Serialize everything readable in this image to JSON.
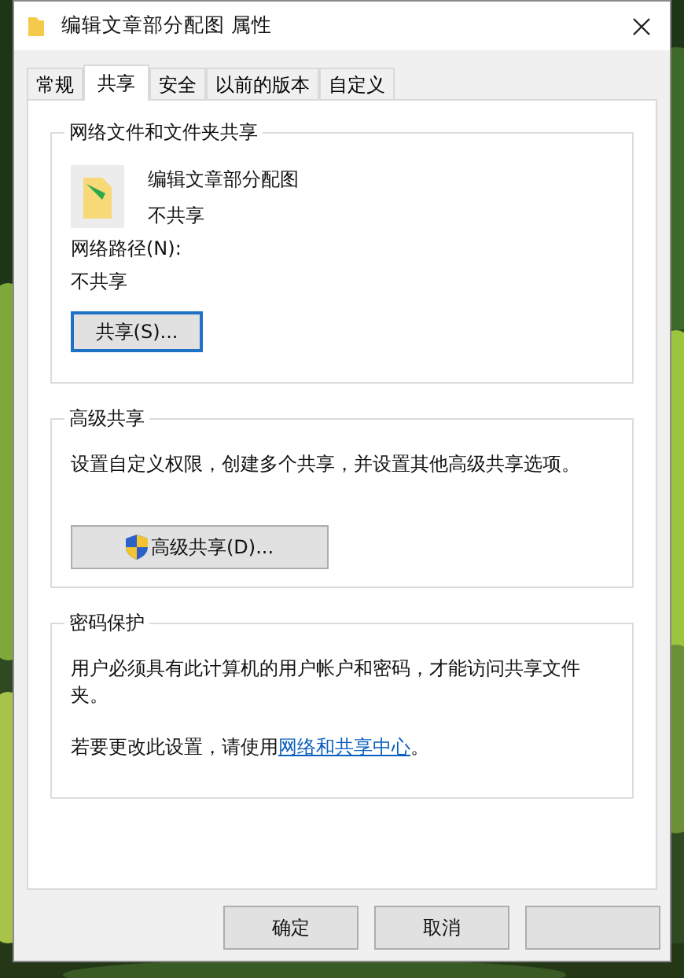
{
  "window": {
    "title": "编辑文章部分配图 属性"
  },
  "tabs": [
    {
      "label": "常规",
      "selected": false
    },
    {
      "label": "共享",
      "selected": true
    },
    {
      "label": "安全",
      "selected": false
    },
    {
      "label": "以前的版本",
      "selected": false
    },
    {
      "label": "自定义",
      "selected": false
    }
  ],
  "network_sharing": {
    "title": "网络文件和文件夹共享",
    "folder_name": "编辑文章部分配图",
    "folder_status": "不共享",
    "path_label": "网络路径(N):",
    "path_value": "不共享",
    "button": {
      "label": "共享(S)...",
      "focused": true
    }
  },
  "advanced_sharing": {
    "title": "高级共享",
    "description": "设置自定义权限，创建多个共享，并设置其他高级共享选项。",
    "button": {
      "label": "高级共享(D)...",
      "focused": false
    }
  },
  "password_protection": {
    "title": "密码保护",
    "description": "用户必须具有此计算机的用户帐户和密码，才能访问共享文件夹。",
    "hint": "若要更改此设置，请使用",
    "link": "网络和共享中心",
    "hint_end": "。"
  },
  "buttons": [
    "确定",
    "取消"
  ]
}
